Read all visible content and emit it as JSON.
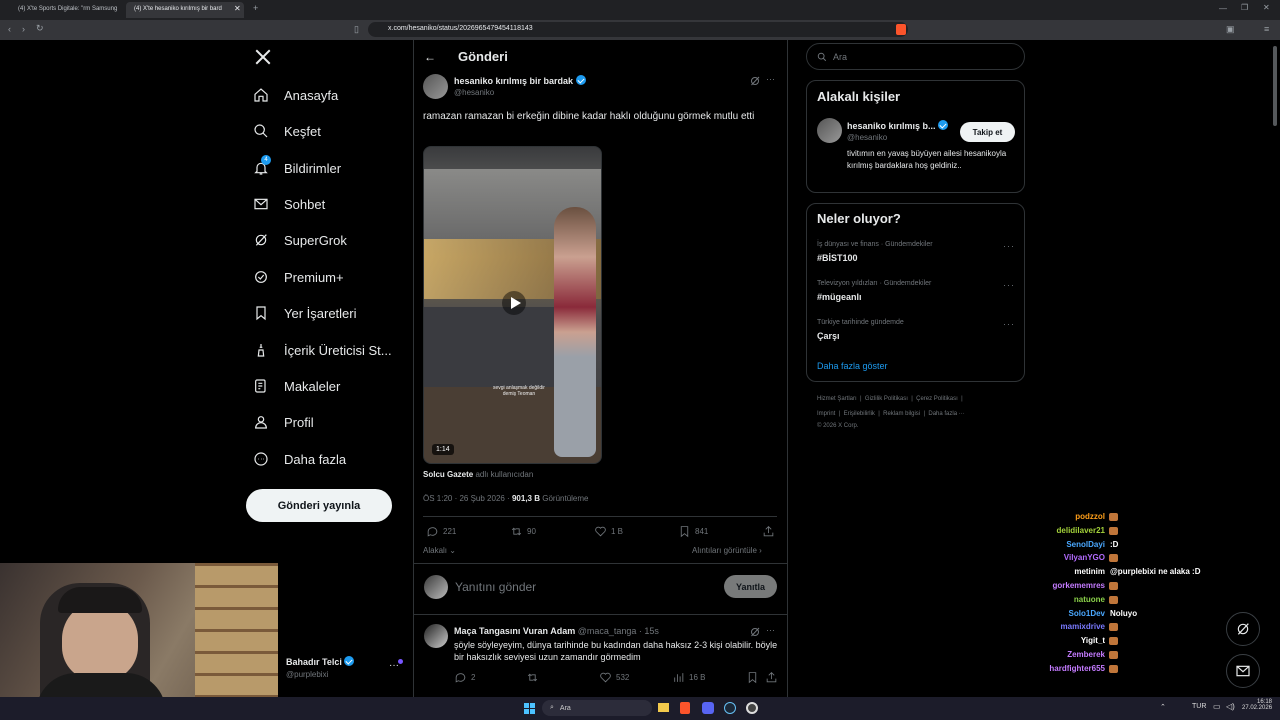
{
  "browser": {
    "tabs": [
      {
        "label": "(4) X'te Sports Digitale: \"rm Samsung",
        "active": false
      },
      {
        "label": "(4) X'te hesaniko kırılmış bir bard",
        "active": true
      }
    ],
    "url": "x.com/hesaniko/status/2026965479454118143"
  },
  "nav": {
    "items": [
      {
        "label": "Anasayfa",
        "icon": "home-icon"
      },
      {
        "label": "Keşfet",
        "icon": "search-icon"
      },
      {
        "label": "Bildirimler",
        "icon": "bell-icon",
        "badge": "4"
      },
      {
        "label": "Sohbet",
        "icon": "mail-icon"
      },
      {
        "label": "SuperGrok",
        "icon": "grok-icon"
      },
      {
        "label": "Premium+",
        "icon": "premium-icon"
      },
      {
        "label": "Yer İşaretleri",
        "icon": "bookmark-icon"
      },
      {
        "label": "İçerik Üreticisi St...",
        "icon": "creator-icon"
      },
      {
        "label": "Makaleler",
        "icon": "article-icon"
      },
      {
        "label": "Profil",
        "icon": "profile-icon"
      },
      {
        "label": "Daha fazla",
        "icon": "more-icon"
      }
    ],
    "post_button": "Gönderi yayınla",
    "account": {
      "name": "Bahadır Telci",
      "handle": "@purplebixi"
    }
  },
  "main": {
    "header_title": "Gönderi",
    "tweet": {
      "author": "hesaniko kırılmış bir bardak",
      "handle": "@hesaniko",
      "text": "ramazan ramazan bi erkeğin dibine kadar haklı olduğunu görmek mutlu etti",
      "video_caption": "sevgi anlaşmak değildir\ndemiş Teoman",
      "video_duration": "1:14",
      "source_name": "Solcu Gazete",
      "source_suffix": "adlı kullanıcıdan",
      "time": "ÖS 1:20 · 26 Şub 2026 ·",
      "views": "901,3 B",
      "views_label": "Görüntüleme",
      "replies": "221",
      "retweets": "90",
      "likes": "1 B",
      "bookmarks": "841",
      "related": "Alakalı",
      "quotes": "Alıntıları görüntüle"
    },
    "reply_placeholder": "Yanıtını gönder",
    "reply_button": "Yanıtla",
    "reply": {
      "author": "Maça Tangasını Vuran Adam",
      "handle": "@maca_tanga",
      "time": "· 15s",
      "text": "şöyle söyleyeyim, dünya tarihinde bu kadından daha haksız 2-3 kişi olabilir. böyle bir haksızlık seviyesi uzun zamandır görmedim",
      "replies": "2",
      "likes": "532",
      "views": "16 B"
    }
  },
  "right": {
    "search_placeholder": "Ara",
    "related_title": "Alakalı kişiler",
    "related_person": {
      "name": "hesaniko kırılmış b...",
      "handle": "@hesaniko",
      "follow": "Takip et",
      "bio": "tivitımın en yavaş büyüyen ailesi hesanikoyla kırılmış bardaklara hoş geldiniz.."
    },
    "trends_title": "Neler oluyor?",
    "trends": [
      {
        "category": "İş dünyası ve finans · Gündemdekiler",
        "name": "#BİST100"
      },
      {
        "category": "Televizyon yıldızları · Gündemdekiler",
        "name": "#mügeanlı"
      },
      {
        "category": "Türkiye tarihinde gündemde",
        "name": "Çarşı"
      }
    ],
    "show_more": "Daha fazla göster",
    "footer_line1": "Hizmet Şartları  |  Gizlilik Politikası  |  Çerez Politikası  |",
    "footer_line2": "Imprint  |  Erişilebilirlik  |  Reklam bilgisi  |  Daha fazla ···",
    "footer_line3": "© 2026 X Corp."
  },
  "chat": [
    {
      "name": "podzzol",
      "color": "#ff9f1a",
      "msg": ""
    },
    {
      "name": "delidilaver21",
      "color": "#a3d13a",
      "msg": ""
    },
    {
      "name": "SenolDayi",
      "color": "#4aa8ff",
      "msg": ":D"
    },
    {
      "name": "VilyanYGO",
      "color": "#b36bff",
      "msg": ""
    },
    {
      "name": "metinim",
      "color": "#ffffff",
      "msg": "@purplebixi ne alaka :D"
    },
    {
      "name": "gorkememres",
      "color": "#c47bff",
      "msg": ""
    },
    {
      "name": "natuone",
      "color": "#8bd14a",
      "msg": ""
    },
    {
      "name": "Solo1Dev",
      "color": "#4aa8ff",
      "msg": "Noluyo"
    },
    {
      "name": "mamixdrive",
      "color": "#7a7aff",
      "msg": ""
    },
    {
      "name": "Yigit_t",
      "color": "#ffffff",
      "msg": ""
    },
    {
      "name": "Zemberek",
      "color": "#c47bff",
      "msg": ""
    },
    {
      "name": "hardfighter655",
      "color": "#c47bff",
      "msg": ""
    }
  ],
  "taskbar": {
    "search": "Ara",
    "lang": "TUR",
    "time": "16:18",
    "date": "27.02.2026"
  },
  "colors": {
    "accent": "#1d9bf0",
    "background": "#000000",
    "border": "#2f3336",
    "muted": "#71767b"
  }
}
